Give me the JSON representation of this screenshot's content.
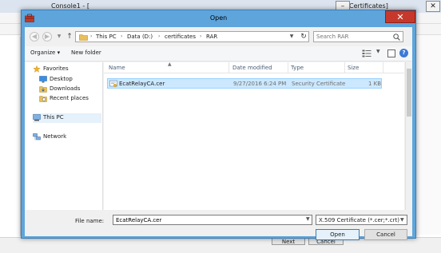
{
  "background_window": {
    "title": "Console1 - [",
    "title_tail": "Certificates]",
    "minimize_glyph": "–",
    "close_glyph": "✕",
    "next_label": "Next",
    "cancel_label": "Cancel"
  },
  "dialog": {
    "title": "Open",
    "close_glyph": "✕",
    "breadcrumb": [
      "This PC",
      "Data (D:)",
      "certificates",
      "RAR"
    ],
    "search_placeholder": "Search RAR",
    "toolbar": {
      "organize": "Organize ▾",
      "new_folder": "New folder"
    },
    "nav": {
      "favorites": "Favorites",
      "desktop": "Desktop",
      "downloads": "Downloads",
      "recent": "Recent places",
      "this_pc": "This PC",
      "network": "Network"
    },
    "columns": {
      "name": "Name",
      "date": "Date modified",
      "type": "Type",
      "size": "Size"
    },
    "files": [
      {
        "name": "EcatRelayCA.cer",
        "date": "9/27/2016 6:24 PM",
        "type": "Security Certificate",
        "size": "1 KB"
      }
    ],
    "file_name_label": "File name:",
    "file_name_value": "EcatRelayCA.cer",
    "file_type_value": "X.509 Certificate (*.cer;*.crt)",
    "open_label": "Open",
    "cancel_label": "Cancel"
  },
  "colors": {
    "accent": "#5ea5dc",
    "close": "#c7382c",
    "selection": "#cce8ff"
  }
}
